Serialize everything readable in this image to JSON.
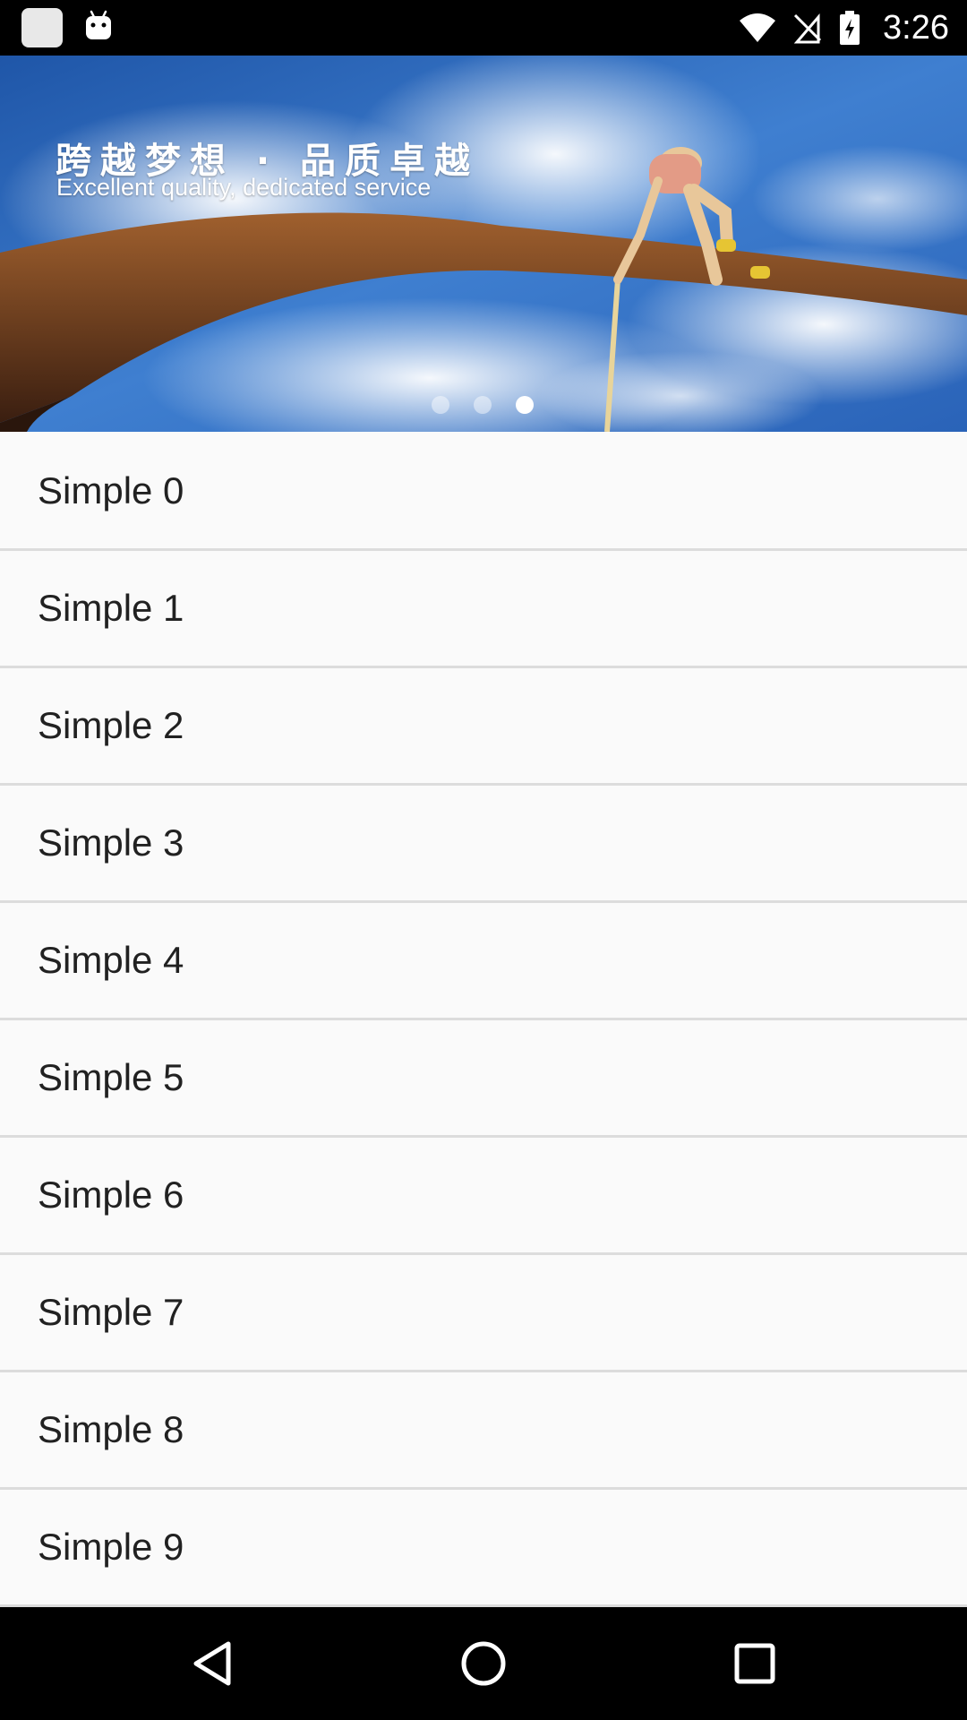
{
  "status_bar": {
    "time": "3:26",
    "icons": [
      "app-icon",
      "android-icon",
      "wifi-icon",
      "no-sim-icon",
      "battery-charging-icon"
    ]
  },
  "banner": {
    "headline_cn": "跨越梦想 · 品质卓越",
    "headline_en": "Excellent quality, dedicated service",
    "page_count": 3,
    "active_page": 3
  },
  "list": {
    "items": [
      {
        "label": "Simple 0"
      },
      {
        "label": "Simple 1"
      },
      {
        "label": "Simple 2"
      },
      {
        "label": "Simple 3"
      },
      {
        "label": "Simple 4"
      },
      {
        "label": "Simple 5"
      },
      {
        "label": "Simple 6"
      },
      {
        "label": "Simple 7"
      },
      {
        "label": "Simple 8"
      },
      {
        "label": "Simple 9"
      }
    ]
  },
  "nav_bar": {
    "icons": [
      "back-icon",
      "home-icon",
      "recents-icon"
    ]
  },
  "colors": {
    "background": "#fafafa",
    "divider": "#dcdcdc",
    "text": "#212121",
    "bars": "#000000"
  }
}
